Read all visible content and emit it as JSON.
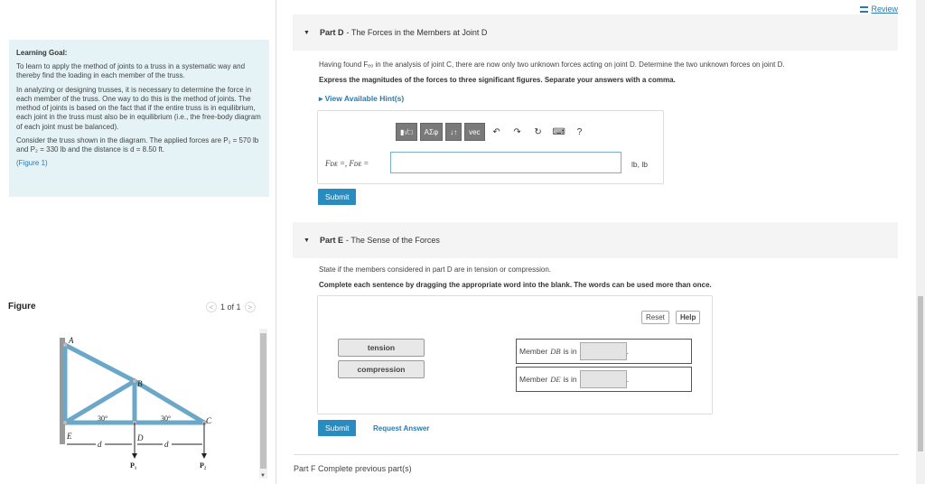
{
  "review": {
    "label": "Review"
  },
  "learning_goal": {
    "title": "Learning Goal:",
    "text1": "To learn to apply the method of joints to a truss in a systematic way and thereby find the loading in each member of the truss.",
    "text2": "In analyzing or designing trusses, it is necessary to determine the force in each member of the truss. One way to do this is the method of joints. The method of joints is based on the fact that if the entire truss is in equilibrium, each joint in the truss must also be in equilibrium (i.e., the free-body diagram of each joint must be balanced).",
    "text3": "Consider the truss shown in the diagram. The applied forces are P₁ = 570 lb and P₂ = 330 lb and the distance is d = 8.50 ft.",
    "figure_link": "(Figure 1)"
  },
  "figure": {
    "title": "Figure",
    "pager": "1 of 1",
    "labels": {
      "a": "A",
      "b": "B",
      "c": "C",
      "d": "D",
      "e": "E",
      "angle_left": "30°",
      "angle_right": "30°",
      "dist_left": "d",
      "dist_right": "d",
      "p1": "P₁",
      "p2": "P₂"
    }
  },
  "part_d": {
    "part": "Part D",
    "title": "- The Forces in the Members at Joint D",
    "text1": "Having found Fₑₒ in the analysis of joint C, there are now only two unknown forces acting on joint D. Determine the two unknown forces on joint D.",
    "text2": "Express the magnitudes of the forces to three significant figures. Separate your answers with a comma.",
    "hint": "View Available Hint(s)",
    "toolbar": {
      "templates": "▮√□",
      "symbols": "AΣφ",
      "arrows": "↓↑",
      "vec": "vec",
      "undo": "↶",
      "redo": "↷",
      "reset": "↻",
      "keyboard": "⌨",
      "help": "?"
    },
    "eq_label": "Fᴅᴇ =, Fᴅᴇ =",
    "unit": "lb, lb",
    "submit": "Submit"
  },
  "part_e": {
    "part": "Part E",
    "title": "- The Sense of the Forces",
    "text1": "State if the members considered in part D are in tension or compression.",
    "text2": "Complete each sentence by dragging the appropriate word into the blank. The words can be used more than once.",
    "reset": "Reset",
    "help": "Help",
    "words": [
      "tension",
      "compression"
    ],
    "sentence1": {
      "pre": "Member",
      "member": "DB",
      "post": "is in"
    },
    "sentence2": {
      "pre": "Member",
      "member": "DE",
      "post": "is in"
    },
    "submit": "Submit",
    "request": "Request Answer"
  },
  "part_f": {
    "part": "Part F",
    "text": "Complete previous part(s)"
  }
}
